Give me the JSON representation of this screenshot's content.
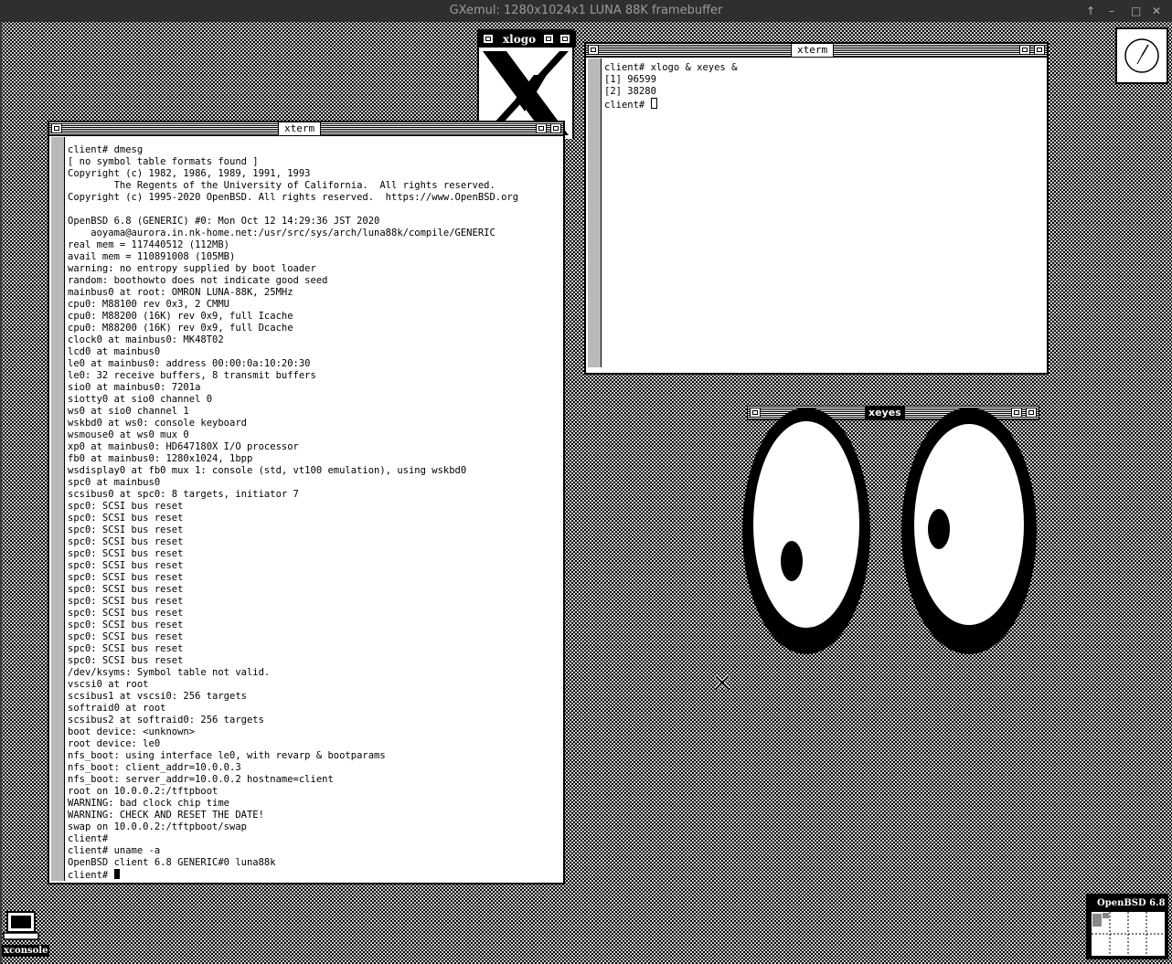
{
  "host": {
    "title": "GXemul: 1280x1024x1 LUNA 88K framebuffer",
    "controls": [
      "↑",
      "–",
      "□",
      "✕"
    ]
  },
  "xterm_main": {
    "title": "xterm",
    "lines": [
      "client# dmesg",
      "[ no symbol table formats found ]",
      "Copyright (c) 1982, 1986, 1989, 1991, 1993",
      "        The Regents of the University of California.  All rights reserved.",
      "Copyright (c) 1995-2020 OpenBSD. All rights reserved.  https://www.OpenBSD.org",
      "",
      "OpenBSD 6.8 (GENERIC) #0: Mon Oct 12 14:29:36 JST 2020",
      "    aoyama@aurora.in.nk-home.net:/usr/src/sys/arch/luna88k/compile/GENERIC",
      "real mem = 117440512 (112MB)",
      "avail mem = 110891008 (105MB)",
      "warning: no entropy supplied by boot loader",
      "random: boothowto does not indicate good seed",
      "mainbus0 at root: OMRON LUNA-88K, 25MHz",
      "cpu0: M88100 rev 0x3, 2 CMMU",
      "cpu0: M88200 (16K) rev 0x9, full Icache",
      "cpu0: M88200 (16K) rev 0x9, full Dcache",
      "clock0 at mainbus0: MK48T02",
      "lcd0 at mainbus0",
      "le0 at mainbus0: address 00:00:0a:10:20:30",
      "le0: 32 receive buffers, 8 transmit buffers",
      "sio0 at mainbus0: 7201a",
      "siotty0 at sio0 channel 0",
      "ws0 at sio0 channel 1",
      "wskbd0 at ws0: console keyboard",
      "wsmouse0 at ws0 mux 0",
      "xp0 at mainbus0: HD647180X I/O processor",
      "fb0 at mainbus0: 1280x1024, 1bpp",
      "wsdisplay0 at fb0 mux 1: console (std, vt100 emulation), using wskbd0",
      "spc0 at mainbus0",
      "scsibus0 at spc0: 8 targets, initiator 7",
      "spc0: SCSI bus reset",
      "spc0: SCSI bus reset",
      "spc0: SCSI bus reset",
      "spc0: SCSI bus reset",
      "spc0: SCSI bus reset",
      "spc0: SCSI bus reset",
      "spc0: SCSI bus reset",
      "spc0: SCSI bus reset",
      "spc0: SCSI bus reset",
      "spc0: SCSI bus reset",
      "spc0: SCSI bus reset",
      "spc0: SCSI bus reset",
      "spc0: SCSI bus reset",
      "spc0: SCSI bus reset",
      "/dev/ksyms: Symbol table not valid.",
      "vscsi0 at root",
      "scsibus1 at vscsi0: 256 targets",
      "softraid0 at root",
      "scsibus2 at softraid0: 256 targets",
      "boot device: <unknown>",
      "root device: le0",
      "nfs_boot: using interface le0, with revarp & bootparams",
      "nfs_boot: client_addr=10.0.0.3",
      "nfs_boot: server_addr=10.0.0.2 hostname=client",
      "root on 10.0.0.2:/tftpboot",
      "WARNING: bad clock chip time",
      "WARNING: CHECK AND RESET THE DATE!",
      "swap on 10.0.0.2:/tftpboot/swap",
      "client#",
      "client# uname -a",
      "OpenBSD client 6.8 GENERIC#0 luna88k"
    ],
    "prompt": "client# "
  },
  "xterm_small": {
    "title": "xterm",
    "lines": [
      "client# xlogo & xeyes &",
      "[1] 96599",
      "[2] 38280"
    ],
    "prompt": "client# "
  },
  "xlogo": {
    "title": "xlogo"
  },
  "xeyes": {
    "title": "xeyes"
  },
  "xconsole": {
    "label": "xconsole"
  },
  "xbiff": {
    "label": "OpenBSD 6.8"
  }
}
